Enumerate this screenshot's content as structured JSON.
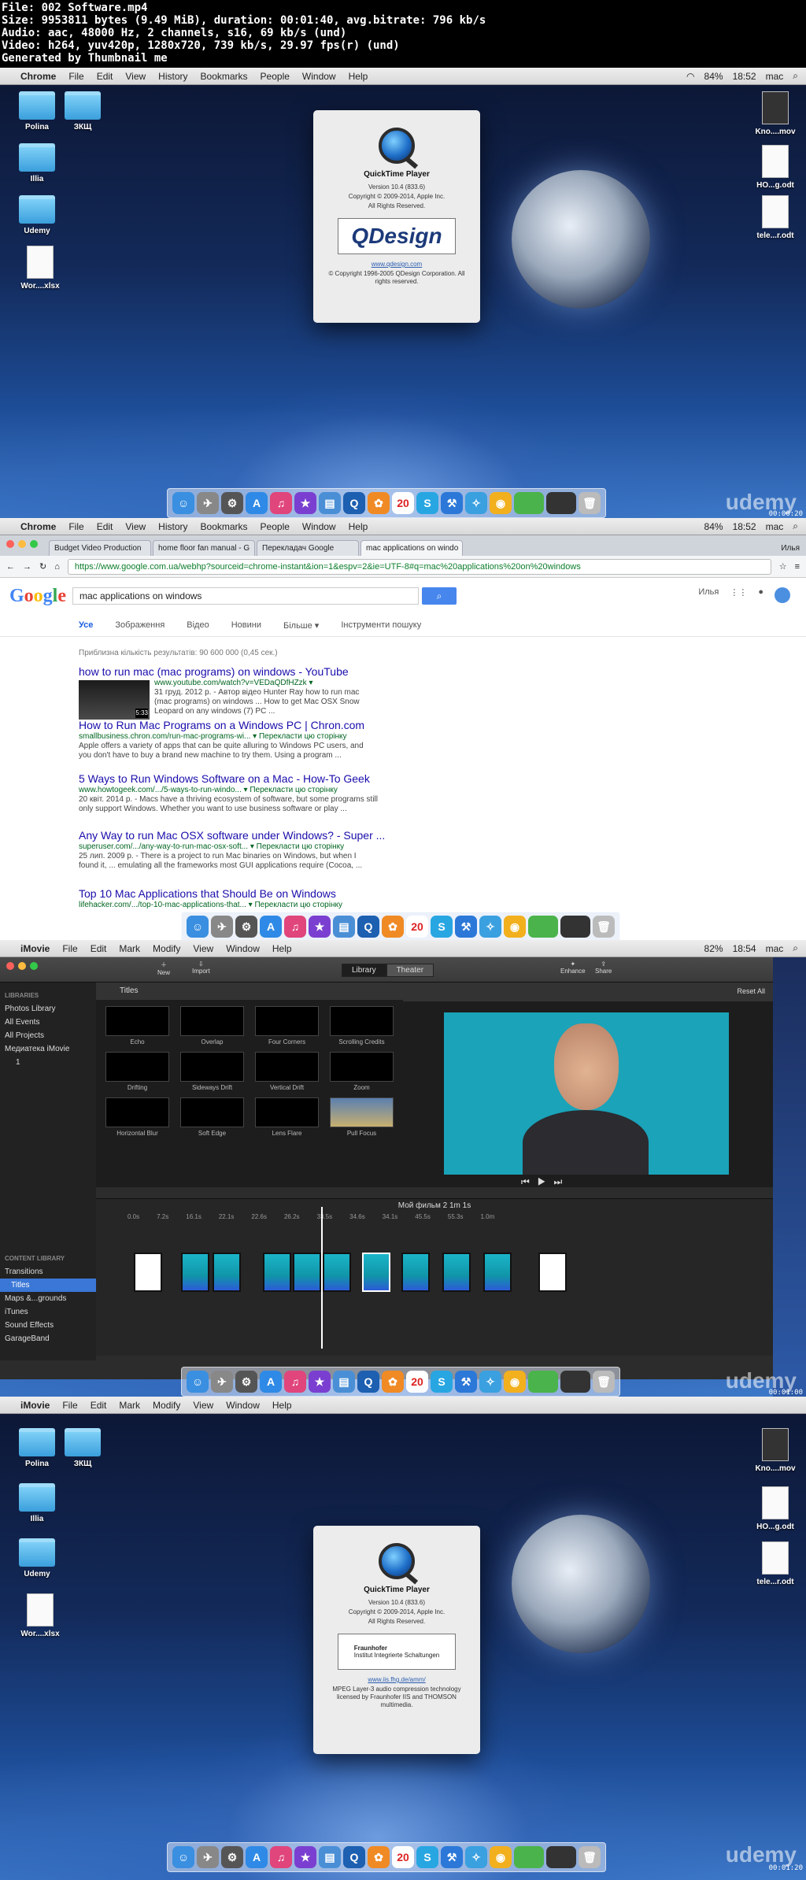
{
  "header": {
    "line1": "File: 002 Software.mp4",
    "line2": "Size: 9953811 bytes (9.49 MiB), duration: 00:01:40, avg.bitrate: 796 kb/s",
    "line3": "Audio: aac, 48000 Hz, 2 channels, s16, 69 kb/s (und)",
    "line4": "Video: h264, yuv420p, 1280x720, 739 kb/s, 29.97 fps(r) (und)",
    "line5": "Generated by Thumbnail me"
  },
  "menubar1": {
    "app": "Chrome",
    "items": [
      "File",
      "Edit",
      "View",
      "History",
      "Bookmarks",
      "People",
      "Window",
      "Help"
    ],
    "battery": "84%",
    "time": "18:52",
    "user": "mac"
  },
  "menubar3": {
    "app": "iMovie",
    "items": [
      "File",
      "Edit",
      "Mark",
      "Modify",
      "View",
      "Window",
      "Help"
    ],
    "battery": "82%",
    "time": "18:54",
    "user": "mac"
  },
  "desktop": {
    "left": [
      "Polina",
      "ЗКЩ",
      "Illia",
      "Udemy",
      "Wor....xlsx"
    ],
    "right": [
      "Kno....mov",
      "HO...g.odt",
      "tele...r.odt"
    ]
  },
  "qt1": {
    "name": "QuickTime Player",
    "version": "Version 10.4 (833.6)",
    "copy": "Copyright © 2009-2014, Apple Inc.",
    "rights": "All Rights Reserved.",
    "logo": "QDesign",
    "link": "www.qdesign.com",
    "copy2": "© Copyright 1996-2005 QDesign Corporation. All rights reserved."
  },
  "qt2": {
    "name": "QuickTime Player",
    "version": "Version 10.4 (833.6)",
    "copy": "Copyright © 2009-2014, Apple Inc.",
    "rights": "All Rights Reserved.",
    "logo1": "Fraunhofer",
    "logo2": "Institut Integrierte Schaltungen",
    "link": "www.iis.fhg.de/amm/",
    "note": "MPEG Layer-3 audio compression technology licensed by Fraunhofer IIS and THOMSON multimedia."
  },
  "udemy": "udemy",
  "stamps": [
    "00:00:20",
    "00:00:40",
    "00:01:00",
    "00:01:20"
  ],
  "chrome": {
    "tabs": [
      "Budget Video Production",
      "home floor fan manual - G",
      "Перекладач Google",
      "mac applications on windo"
    ],
    "url": "https://www.google.com.ua/webhp?sourceid=chrome-instant&ion=1&espv=2&ie=UTF-8#q=mac%20applications%20on%20windows",
    "user": "Илья"
  },
  "google": {
    "logo": "Google",
    "query": "mac applications on windows",
    "nav": [
      "Усе",
      "Зображення",
      "Відео",
      "Новини",
      "Більше ▾",
      "Інструменти пошуку"
    ],
    "count": "Приблизна кількість результатів: 90 600 000 (0,45 сек.)",
    "results": [
      {
        "title": "how to run mac (mac programs) on windows - YouTube",
        "url": "www.youtube.com/watch?v=VEDaQDfHZzk ▾",
        "snip": "31 груд. 2012 р. - Автор відео Hunter Ray how to run mac (mac programs) on windows ... How to get Mac OSX Snow Leopard on any windows (7) PC ..."
      },
      {
        "title": "How to Run Mac Programs on a Windows PC | Chron.com",
        "url": "smallbusiness.chron.com/run-mac-programs-wi... ▾ Перекласти цю сторінку",
        "snip": "Apple offers a variety of apps that can be quite alluring to Windows PC users, and you don't have to buy a brand new machine to try them. Using a program ..."
      },
      {
        "title": "5 Ways to Run Windows Software on a Mac - How-To Geek",
        "url": "www.howtogeek.com/.../5-ways-to-run-windo... ▾ Перекласти цю сторінку",
        "snip": "20 квіт. 2014 р. - Macs have a thriving ecosystem of software, but some programs still only support Windows. Whether you want to use business software or play ..."
      },
      {
        "title": "Any Way to run Mac OSX software under Windows? - Super ...",
        "url": "superuser.com/.../any-way-to-run-mac-osx-soft... ▾ Перекласти цю сторінку",
        "snip": "25 лип. 2009 р. - There is a project to run Mac binaries on Windows, but when I found it, ... emulating all the frameworks most GUI applications require (Cocoa, ..."
      },
      {
        "title": "Top 10 Mac Applications that Should Be on Windows",
        "url": "lifehacker.com/.../top-10-mac-applications-that... ▾ Перекласти цю сторінку",
        "snip": ""
      }
    ]
  },
  "imovie": {
    "library": "Library",
    "theater": "Theater",
    "new": "New",
    "import": "Import",
    "enhance": "Enhance",
    "share": "Share",
    "reset": "Reset All",
    "titles": "Titles",
    "libraries": "LIBRARIES",
    "libs": [
      "Photos Library",
      "All Events",
      "All Projects",
      "Медиатека iMovie",
      "1"
    ],
    "content": "CONTENT LIBRARY",
    "contentItems": [
      "Transitions",
      "Titles",
      "Maps &...grounds",
      "iTunes",
      "Sound Effects",
      "GarageBand"
    ],
    "tiles": [
      "Echo",
      "Overlap",
      "Four Corners",
      "Scrolling Credits",
      "Drifting",
      "Sideways Drift",
      "Vertical Drift",
      "Zoom",
      "Horizontal Blur",
      "Soft Edge",
      "Lens Flare",
      "Pull Focus"
    ],
    "project": "Мой фильм 2",
    "duration": "1m 1s",
    "ruler": [
      "0.0s",
      "7.2s",
      "16.1s",
      "22.1s",
      "22.6s",
      "26.2s",
      "33.5s",
      "34.6s",
      "34.1s",
      "45.5s",
      "55.3s",
      "1.0m"
    ]
  },
  "colors": {
    "accent": "#3a77d6",
    "google_blue": "#4787ed",
    "link": "#1a0dab"
  }
}
